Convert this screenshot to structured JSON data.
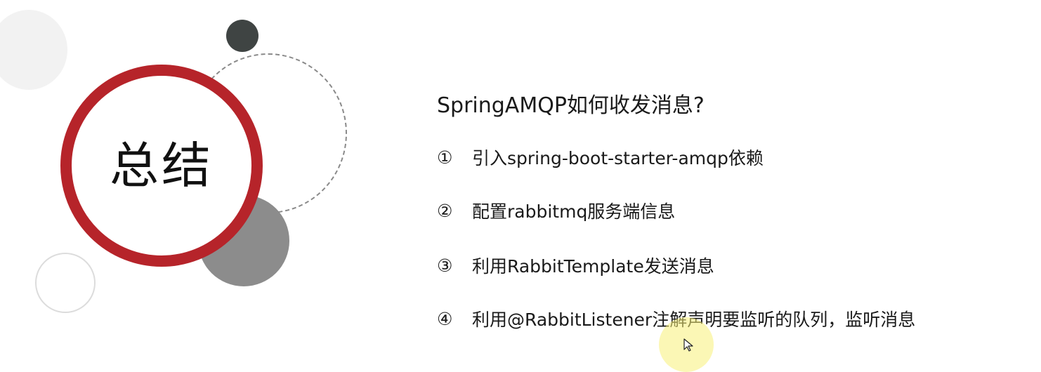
{
  "slide": {
    "title": "总结",
    "question": "SpringAMQP如何收发消息?",
    "items": [
      {
        "num": "①",
        "text": "引入spring-boot-starter-amqp依赖"
      },
      {
        "num": "②",
        "text": "配置rabbitmq服务端信息"
      },
      {
        "num": "③",
        "text": "利用RabbitTemplate发送消息"
      },
      {
        "num": "④",
        "text": "利用@RabbitListener注解声明要监听的队列，监听消息"
      }
    ]
  },
  "colors": {
    "accent_red": "#b6242a",
    "dark_dot": "#3f4443",
    "gray_circle": "#8c8c8c",
    "cursor_highlight": "#f8f078"
  },
  "icons": {
    "cursor": "mouse-pointer-icon"
  }
}
